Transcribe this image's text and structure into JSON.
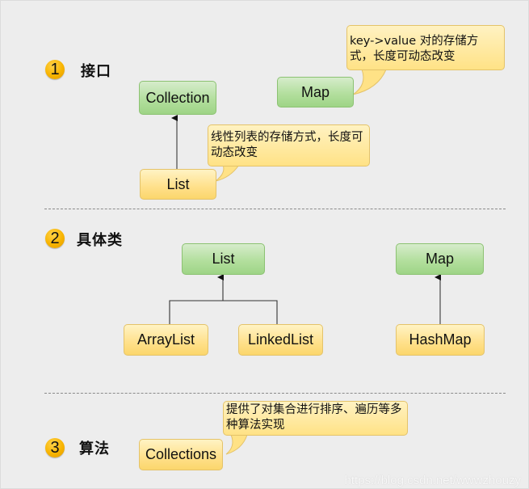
{
  "sections": [
    {
      "number": "1",
      "title": "接口"
    },
    {
      "number": "2",
      "title": "具体类"
    },
    {
      "number": "3",
      "title": "算法"
    }
  ],
  "interfaces": {
    "collection": "Collection",
    "map": "Map",
    "list": "List",
    "map_note": "key->value 对的存储方式，长度可动态改变",
    "list_note": "线性列表的存储方式，长度可动态改变"
  },
  "concrete": {
    "list": "List",
    "map": "Map",
    "arraylist": "ArrayList",
    "linkedlist": "LinkedList",
    "hashmap": "HashMap"
  },
  "algorithms": {
    "collections": "Collections",
    "note": "提供了对集合进行排序、遍历等多种算法实现"
  },
  "colors": {
    "interface_fill": "#b3df9e",
    "class_fill": "#ffe08a",
    "badge": "#f8b400",
    "background": "#ededed"
  },
  "watermark": "https://blog.csdn.net/wwwzhouzy"
}
